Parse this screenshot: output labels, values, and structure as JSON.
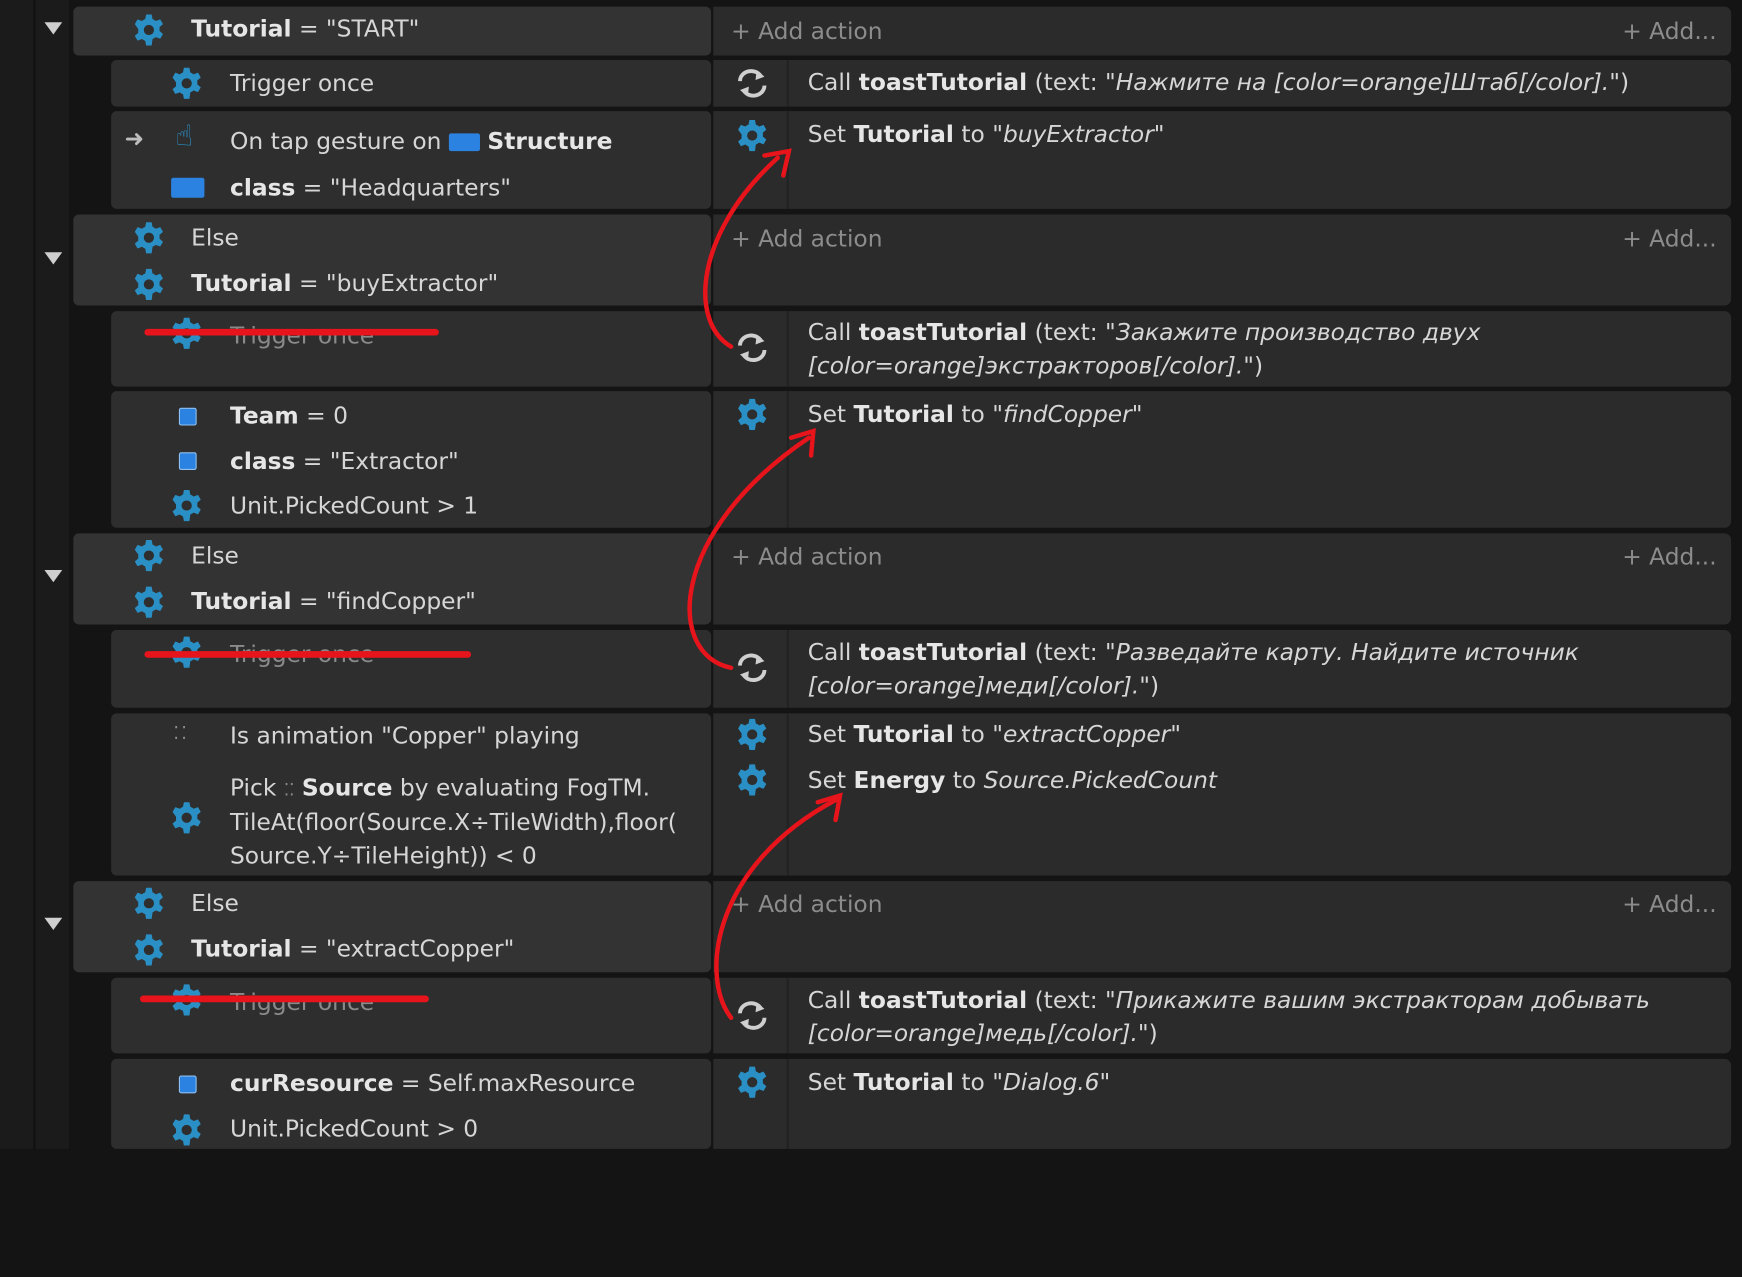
{
  "add_action_label": "Add action",
  "add_label": "Add...",
  "events": [
    {
      "conditions": [
        {
          "name": "Tutorial",
          "op": "=",
          "value": "\"START\""
        }
      ],
      "subs": [
        {
          "conditions": [
            {
              "text": "Trigger once"
            }
          ],
          "actions": [
            {
              "call": "Call",
              "fn": "toastTutorial",
              "args": "(text: ",
              "str": "\"Нажмите на [color=orange]Штаб[/color].\"",
              "close": ")"
            }
          ]
        },
        {
          "conditions": [
            {
              "text": "On tap gesture on",
              "object": "Structure"
            },
            {
              "name": "class",
              "op": "=",
              "value": "\"Headquarters\""
            }
          ],
          "actions": [
            {
              "verb": "Set",
              "var": "Tutorial",
              "to": "to",
              "value": "\"buyExtractor\""
            }
          ]
        }
      ]
    },
    {
      "else": "Else",
      "conditions": [
        {
          "name": "Tutorial",
          "op": "=",
          "value": "\"buyExtractor\""
        }
      ],
      "subs": [
        {
          "conditions": [
            {
              "text": "Trigger once"
            }
          ],
          "actions": [
            {
              "call": "Call",
              "fn": "toastTutorial",
              "args": "(text: ",
              "str": "\"Закажите производство двух",
              "str2": "[color=orange]экстракторов[/color].\"",
              "close": ")"
            }
          ]
        },
        {
          "conditions": [
            {
              "name": "Team",
              "op": "=",
              "value": "0"
            },
            {
              "name": "class",
              "op": "=",
              "value": "\"Extractor\""
            },
            {
              "text": "Unit.PickedCount > 1"
            }
          ],
          "actions": [
            {
              "verb": "Set",
              "var": "Tutorial",
              "to": "to",
              "value": "\"findCopper\""
            }
          ]
        }
      ]
    },
    {
      "else": "Else",
      "conditions": [
        {
          "name": "Tutorial",
          "op": "=",
          "value": "\"findCopper\""
        }
      ],
      "subs": [
        {
          "conditions": [
            {
              "text": "Trigger once"
            }
          ],
          "actions": [
            {
              "call": "Call",
              "fn": "toastTutorial",
              "args": "(text: ",
              "str": "\"Разведайте карту. Найдите источник",
              "str2": "[color=orange]меди[/color].\"",
              "close": ")"
            }
          ]
        },
        {
          "conditions": [
            {
              "text": "Is animation \"Copper\" playing"
            },
            {
              "pick": "Pick",
              "object": "Source",
              "rest": "by evaluating FogTM.",
              "line2": "TileAt(floor(Source.X÷TileWidth),floor(",
              "line3": "Source.Y÷TileHeight)) < 0"
            }
          ],
          "actions": [
            {
              "verb": "Set",
              "var": "Tutorial",
              "to": "to",
              "value": "\"extractCopper\""
            },
            {
              "verb": "Set",
              "var": "Energy",
              "to": "to",
              "value": "Source.PickedCount"
            }
          ]
        }
      ]
    },
    {
      "else": "Else",
      "conditions": [
        {
          "name": "Tutorial",
          "op": "=",
          "value": "\"extractCopper\""
        }
      ],
      "subs": [
        {
          "conditions": [
            {
              "text": "Trigger once"
            }
          ],
          "actions": [
            {
              "call": "Call",
              "fn": "toastTutorial",
              "args": "(text: ",
              "str": "\"Прикажите вашим экстракторам добывать",
              "str2": "[color=orange]медь[/color].\"",
              "close": ")"
            }
          ]
        },
        {
          "conditions": [
            {
              "name": "curResource",
              "op": "=",
              "value": "Self.maxResource"
            },
            {
              "text": "Unit.PickedCount > 0"
            }
          ],
          "actions": [
            {
              "verb": "Set",
              "var": "Tutorial",
              "to": "to",
              "value": "\"Dialog.6\""
            }
          ]
        }
      ]
    }
  ],
  "colors": {
    "annotation_red": "#e8141b",
    "object_blue": "#2b82e0",
    "gear_blue": "#2a8fc4"
  }
}
